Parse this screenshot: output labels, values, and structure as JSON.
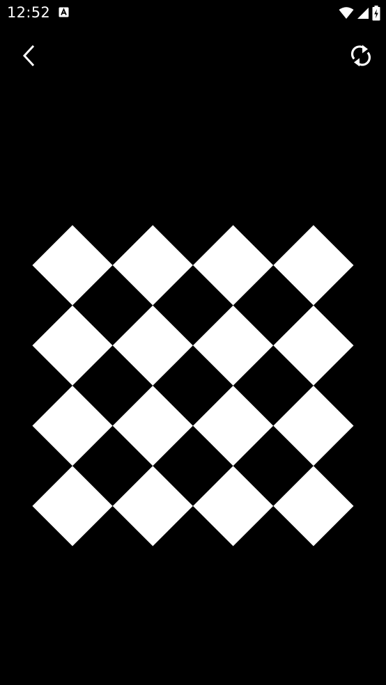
{
  "status_bar": {
    "time": "12:52",
    "icons": [
      "text-notification-icon",
      "wifi-icon",
      "cellular-signal-icon",
      "battery-charging-icon"
    ]
  },
  "toolbar": {
    "back_icon": "chevron-left-icon",
    "refresh_icon": "refresh-icon"
  },
  "board": {
    "rows": 4,
    "cols": 4,
    "tile_color": "#ffffff",
    "background_color": "#000000"
  }
}
